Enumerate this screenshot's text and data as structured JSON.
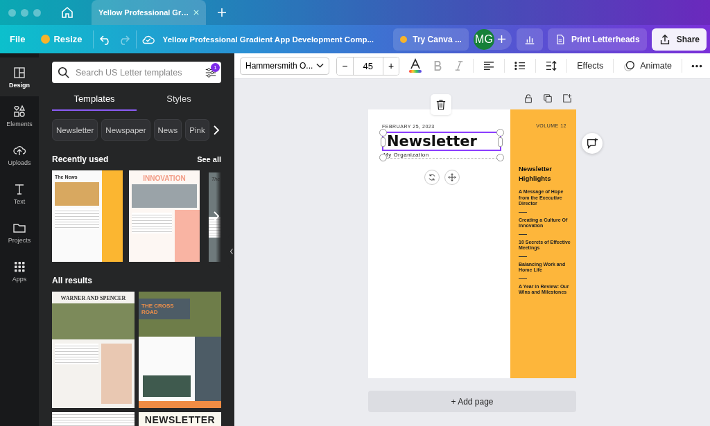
{
  "browser": {
    "tabs": [
      {
        "label": "Yellow Professional Gr…",
        "selected": true
      }
    ]
  },
  "menu_bar": {
    "file": "File",
    "resize": "Resize",
    "title": "Yellow Professional Gradient App Development Comp...",
    "try": "Try Canva ...",
    "avatar": "MG",
    "print": "Print Letterheads",
    "share": "Share"
  },
  "side_rail": [
    {
      "label": "Design",
      "selected": true
    },
    {
      "label": "Elements",
      "selected": false
    },
    {
      "label": "Uploads",
      "selected": false
    },
    {
      "label": "Text",
      "selected": false
    },
    {
      "label": "Projects",
      "selected": false
    },
    {
      "label": "Apps",
      "selected": false
    }
  ],
  "panel": {
    "search": {
      "placeholder": "Search US Letter templates",
      "filter_count": "1"
    },
    "tabs": [
      {
        "label": "Templates",
        "selected": true
      },
      {
        "label": "Styles",
        "selected": false
      }
    ],
    "chips": [
      "Newsletter",
      "Newspaper",
      "News",
      "Pink"
    ],
    "recent_heading": "Recently used",
    "see_all": "See all",
    "recent": [
      {
        "kind": "columns",
        "title": "The News"
      },
      {
        "kind": "banner",
        "title": "INNOVATION"
      },
      {
        "kind": "photo",
        "title": "The"
      }
    ],
    "all_heading": "All results",
    "results": [
      {
        "kind": "warner",
        "title": "WARNER AND SPENCER"
      },
      {
        "kind": "crossroad",
        "title": "THE CROSS ROAD"
      },
      {
        "kind": "plain"
      },
      {
        "kind": "masthead",
        "title": "NEWSLETTER"
      }
    ]
  },
  "format_bar": {
    "font": "Hammersmith O...",
    "minus": "−",
    "size": "45",
    "plus": "+",
    "effects": "Effects",
    "animate": "Animate"
  },
  "page": {
    "date": "FEBRUARY 25, 2023",
    "title": "Newsletter",
    "org": "My Organization",
    "volume": "VOLUME 12",
    "highlights_title": "Newsletter Highlights",
    "highlights": [
      "A Message of Hope from the Executive Director",
      "Creating a Culture Of Innovation",
      "10 Secrets of Effective Meetings",
      "Balancing Work and Home Life",
      "A Year in Review: Our Wins and Milestones"
    ]
  },
  "add_page": "+ Add page"
}
